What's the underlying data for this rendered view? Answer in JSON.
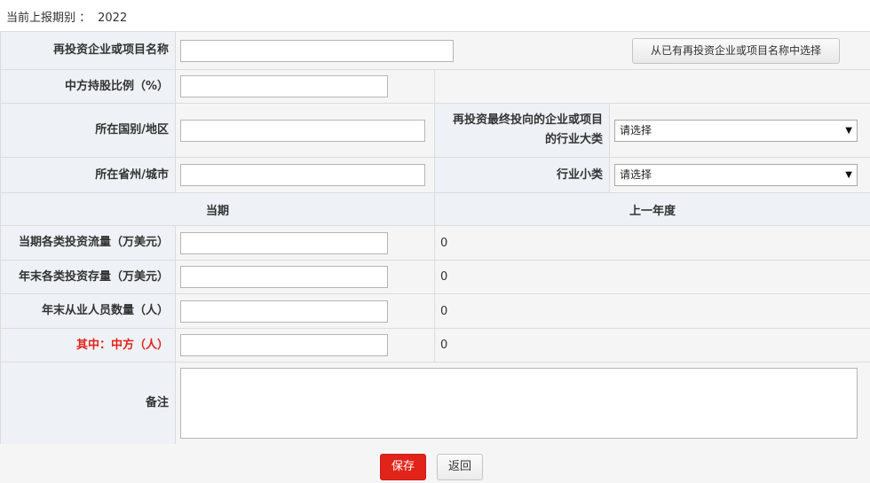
{
  "period": {
    "label": "当前上报期别 ：",
    "value": "2022"
  },
  "form": {
    "enterprise_name": {
      "label": "再投资企业或项目名称",
      "value": "",
      "pick_button": "从已有再投资企业或项目名称中选择"
    },
    "share_ratio": {
      "label": "中方持股比例（%）",
      "value": ""
    },
    "country": {
      "label": "所在国别/地区",
      "value": ""
    },
    "industry_major": {
      "label_line1": "再投资最终投向的企业或项目",
      "label_line2": "的行业大类",
      "selected": "请选择"
    },
    "province_city": {
      "label": "所在省州/城市",
      "value": ""
    },
    "industry_minor": {
      "label": "行业小类",
      "selected": "请选择"
    },
    "columns": {
      "current": "当期",
      "previous": "上一年度"
    },
    "rows": [
      {
        "label": "当期各类投资流量（万美元）",
        "value": "",
        "previous": "0"
      },
      {
        "label": "年末各类投资存量（万美元）",
        "value": "",
        "previous": "0"
      },
      {
        "label": "年末从业人员数量（人）",
        "value": "",
        "previous": "0"
      },
      {
        "label": "其中：中方（人）",
        "value": "",
        "previous": "0"
      }
    ],
    "remark": {
      "label": "备注",
      "value": ""
    }
  },
  "buttons": {
    "save": "保存",
    "back": "返回"
  },
  "colors": {
    "primary": "#e2231a",
    "label_bg": "#eef2f6",
    "cell_bg": "#f5f5f5"
  }
}
